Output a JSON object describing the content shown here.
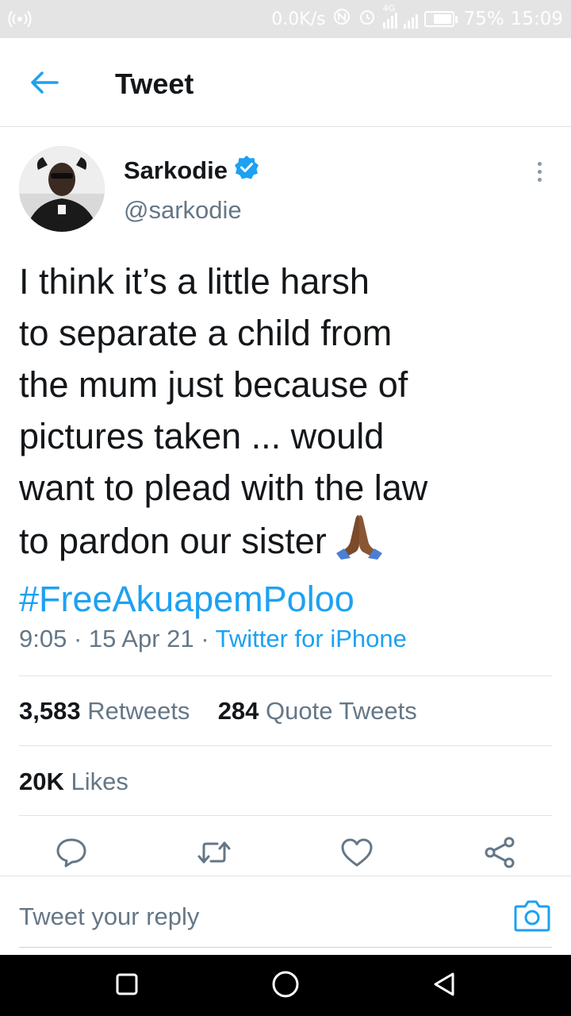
{
  "status_bar": {
    "speed": "0.0K/s",
    "network_badge": "4G",
    "battery_percent": "75%",
    "battery_level": 0.75,
    "time": "15:09",
    "icons": [
      "wifi-hotspot-icon",
      "nfc-icon",
      "alarm-icon",
      "signal-icon",
      "battery-icon"
    ]
  },
  "header": {
    "title": "Tweet",
    "back_icon": "arrow-left-icon"
  },
  "tweet": {
    "author_name": "Sarkodie",
    "author_handle": "@sarkodie",
    "verified": true,
    "text_lines": [
      "I think it’s a little harsh",
      "to separate a child from",
      "the mum just because of",
      "pictures taken ... would",
      "want to plead with the law",
      "to pardon our sister"
    ],
    "emoji": "folded-hands-emoji",
    "hashtag": "#FreeAkuapemPoloo",
    "time": "9:05",
    "separator": "·",
    "date": "15 Apr 21",
    "source": "Twitter for iPhone"
  },
  "stats": {
    "retweets_count": "3,583",
    "retweets_label": "Retweets",
    "quotes_count": "284",
    "quotes_label": "Quote Tweets",
    "likes_count": "20K",
    "likes_label": "Likes"
  },
  "actions": [
    "reply-icon",
    "retweet-icon",
    "like-icon",
    "share-icon"
  ],
  "reply_bar": {
    "placeholder": "Tweet your reply",
    "camera_icon": "camera-icon"
  },
  "nav_bar": [
    "recents-square-icon",
    "home-circle-icon",
    "back-triangle-icon"
  ],
  "colors": {
    "accent": "#1da1f2",
    "text_primary": "#14171a",
    "text_secondary": "#657786",
    "divider": "#dfe3e6",
    "status_bar_bg": "#e4e4e4",
    "nav_bar_bg": "#000000"
  }
}
